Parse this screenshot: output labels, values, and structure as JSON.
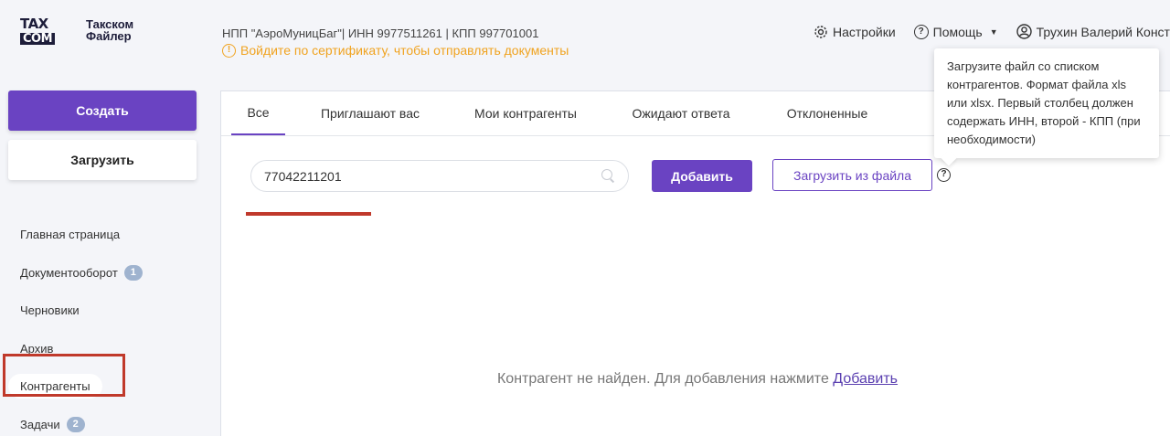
{
  "logo": {
    "tax": "TAX",
    "com": "COM",
    "line1": "Такском",
    "line2": "Файлер"
  },
  "header": {
    "org_info": "НПП \"АэроМуницБаг\"| ИНН 9977511261 | КПП 997701001",
    "warning": "Войдите по сертификату, чтобы отправлять документы",
    "warning_icon": "!",
    "settings_label": "Настройки",
    "help_label": "Помощь",
    "user_name": "Трухин Валерий Констан"
  },
  "sidebar": {
    "create_label": "Создать",
    "upload_label": "Загрузить",
    "items": [
      {
        "label": "Главная страница"
      },
      {
        "label": "Документооборот",
        "badge": "1"
      },
      {
        "label": "Черновики"
      },
      {
        "label": "Архив"
      },
      {
        "label": "Контрагенты"
      },
      {
        "label": "Задачи",
        "badge": "2"
      }
    ]
  },
  "tabs": [
    {
      "label": "Все"
    },
    {
      "label": "Приглашают вас"
    },
    {
      "label": "Мои контрагенты"
    },
    {
      "label": "Ожидают ответа"
    },
    {
      "label": "Отклоненные"
    }
  ],
  "search": {
    "value": "77042211201"
  },
  "actions": {
    "add_label": "Добавить",
    "upload_file_label": "Загрузить из файла"
  },
  "help_glyph": "?",
  "tooltip": {
    "text": "Загрузите файл со списком контрагентов. Формат файла xls или xlsx. Первый столбец должен содержать ИНН, второй - КПП (при необходимости)"
  },
  "empty_state": {
    "text": "Контрагент не найден. Для добавления нажмите",
    "link": "Добавить"
  },
  "colors": {
    "accent": "#6a43c2",
    "warning": "#f0a320",
    "highlight": "#c0392b"
  }
}
